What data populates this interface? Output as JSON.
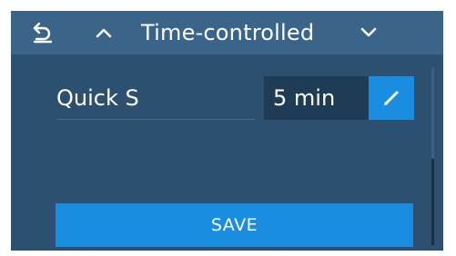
{
  "header": {
    "title": "Time-controlled",
    "back_icon": "undo-arrow-icon",
    "up_icon": "chevron-up-icon",
    "down_icon": "chevron-down-icon"
  },
  "setting": {
    "name": "Quick S",
    "value": "5 min",
    "edit_icon": "pencil-icon"
  },
  "actions": {
    "save_label": "SAVE"
  },
  "colors": {
    "background": "#2d5070",
    "header": "#3a6488",
    "accent": "#1a8de0",
    "value_box": "#1f3c56"
  }
}
